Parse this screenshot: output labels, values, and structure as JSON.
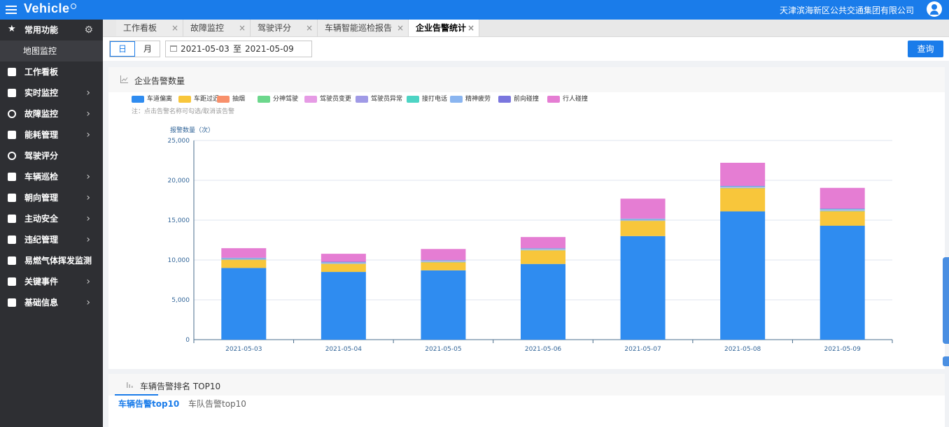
{
  "app": {
    "brand": "Vehicle",
    "company": "天津滨海新区公共交通集团有限公司"
  },
  "sidebar": {
    "items": [
      {
        "label": "常用功能",
        "icon": "star-icon",
        "has_gear": true
      },
      {
        "label": "地图监控",
        "sub": true
      },
      {
        "label": "工作看板",
        "icon": "board-icon"
      },
      {
        "label": "实时监控",
        "icon": "monitor-icon",
        "chevron": true
      },
      {
        "label": "故障监控",
        "icon": "alarm-light-icon",
        "chevron": true
      },
      {
        "label": "能耗管理",
        "icon": "fuel-icon",
        "chevron": true
      },
      {
        "label": "驾驶评分",
        "icon": "steering-wheel-icon"
      },
      {
        "label": "车辆巡检",
        "icon": "bus-icon",
        "chevron": true
      },
      {
        "label": "朝向管理",
        "icon": "direction-icon",
        "chevron": true
      },
      {
        "label": "主动安全",
        "icon": "shield-icon",
        "chevron": true
      },
      {
        "label": "违纪管理",
        "icon": "violation-icon",
        "chevron": true
      },
      {
        "label": "易燃气体挥发监测",
        "icon": "gas-bus-icon"
      },
      {
        "label": "关键事件",
        "icon": "event-icon",
        "chevron": true
      },
      {
        "label": "基础信息",
        "icon": "user-info-icon",
        "chevron": true
      }
    ]
  },
  "tabs": [
    {
      "label": "工作看板"
    },
    {
      "label": "故障监控"
    },
    {
      "label": "驾驶评分"
    },
    {
      "label": "车辆智能巡检报告"
    },
    {
      "label": "企业告警统计",
      "active": true
    }
  ],
  "toolbar": {
    "day_label": "日",
    "month_label": "月",
    "date_from": "2021-05-03",
    "date_sep": "至",
    "date_to": "2021-05-09",
    "query_label": "查询"
  },
  "panel": {
    "title": "企业告警数量",
    "note": "注：点击告警名称可勾选/取消该告警"
  },
  "chart_data": {
    "type": "bar",
    "stacked": true,
    "ylabel": "报警数量（次）",
    "ylim": [
      0,
      25000
    ],
    "yticks": [
      "0",
      "5,000",
      "10,000",
      "15,000",
      "20,000",
      "25,000"
    ],
    "ytick_values": [
      0,
      5000,
      10000,
      15000,
      20000,
      25000
    ],
    "categories": [
      "2021-05-03",
      "2021-05-04",
      "2021-05-05",
      "2021-05-06",
      "2021-05-07",
      "2021-05-08",
      "2021-05-09"
    ],
    "legend_position": "top-left",
    "series": [
      {
        "name": "车道偏离",
        "color": "#2f8cf0",
        "values": [
          9000,
          8500,
          8700,
          9500,
          13000,
          16100,
          14300
        ]
      },
      {
        "name": "车距过近",
        "color": "#f8c63b",
        "values": [
          1000,
          1000,
          1000,
          1700,
          1900,
          2900,
          1800
        ]
      },
      {
        "name": "抽烟",
        "color": "#f8906b",
        "values": [
          0,
          0,
          0,
          0,
          0,
          0,
          0
        ]
      },
      {
        "name": "分神驾驶",
        "color": "#6cd78c",
        "values": [
          50,
          50,
          50,
          50,
          50,
          50,
          60
        ]
      },
      {
        "name": "驾驶员变更",
        "color": "#e69be5",
        "values": [
          50,
          50,
          50,
          50,
          50,
          50,
          50
        ]
      },
      {
        "name": "驾驶员异常",
        "color": "#a09ae6",
        "values": [
          50,
          50,
          50,
          50,
          50,
          50,
          50
        ]
      },
      {
        "name": "接打电话",
        "color": "#4dd4c4",
        "values": [
          40,
          40,
          40,
          40,
          50,
          50,
          80
        ]
      },
      {
        "name": "精神疲劳",
        "color": "#8ab5f0",
        "values": [
          40,
          40,
          40,
          40,
          50,
          50,
          60
        ]
      },
      {
        "name": "前向碰撞",
        "color": "#7a76de",
        "values": [
          50,
          50,
          50,
          50,
          50,
          50,
          50
        ]
      },
      {
        "name": "行人碰撞",
        "color": "#e57dd3",
        "values": [
          1200,
          1000,
          1400,
          1400,
          2500,
          2900,
          2600
        ]
      }
    ]
  },
  "panel2": {
    "title": "车辆告警排名 TOP10",
    "tab_vehicle": "车辆告警top10",
    "tab_fleet": "车队告警top10"
  }
}
